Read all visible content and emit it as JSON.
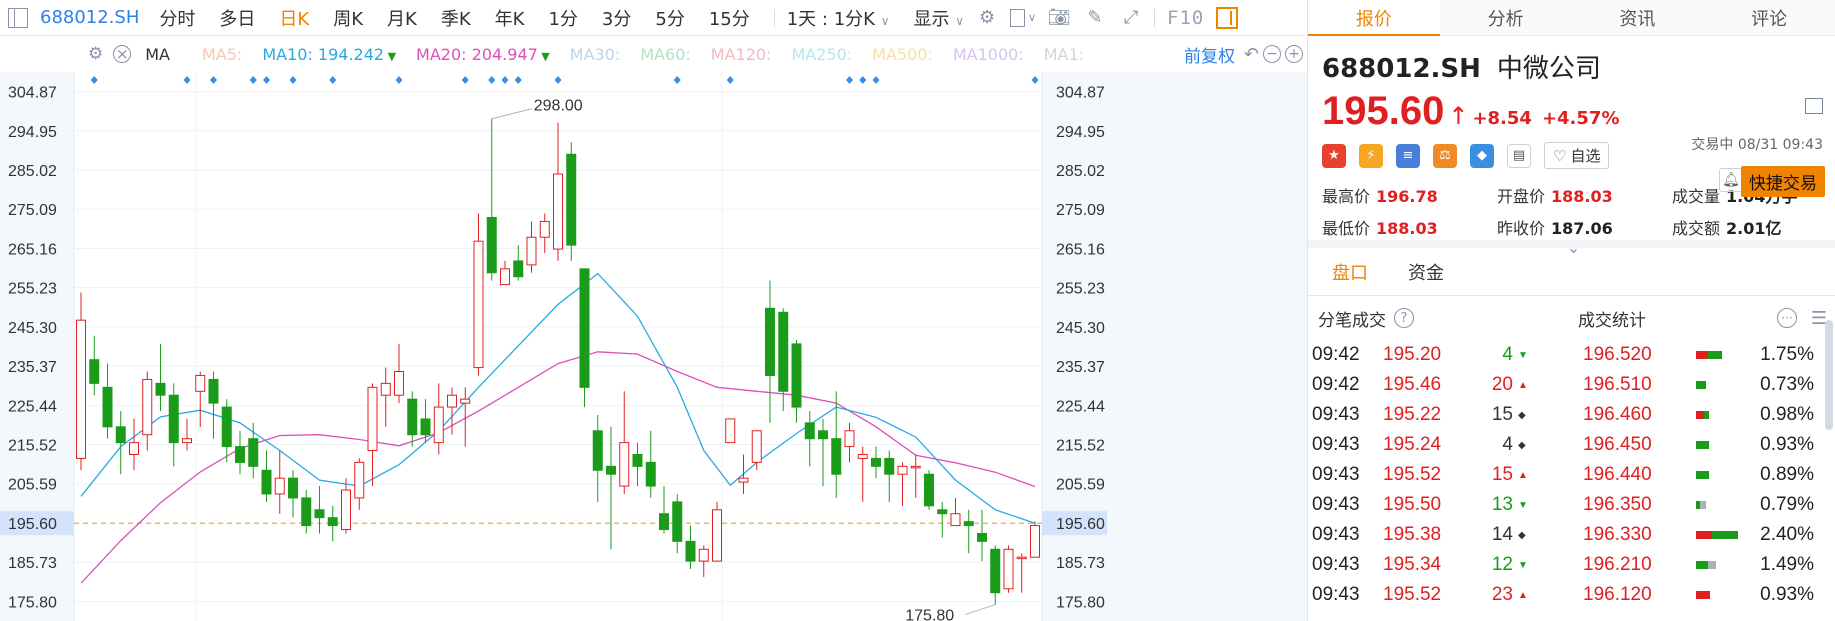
{
  "toolbar": {
    "symbol": "688012.SH",
    "periods": [
      "分时",
      "多日",
      "日K",
      "周K",
      "月K",
      "季K",
      "年K",
      "1分",
      "3分",
      "5分",
      "15分"
    ],
    "active_period": "日K",
    "range": "1天 : 1分K",
    "display": "显示",
    "f10": "F10"
  },
  "ma": {
    "label": "MA",
    "items": [
      {
        "text": "MA5:",
        "color": "#f6c6b3"
      },
      {
        "text": "MA10: 194.242",
        "color": "#29a9e1",
        "arrow": "down",
        "arrow_color": "#1a9c1a"
      },
      {
        "text": "MA20: 204.947",
        "color": "#de4fb8",
        "arrow": "down",
        "arrow_color": "#1a9c1a"
      },
      {
        "text": "MA30:",
        "color": "#b8d4ec"
      },
      {
        "text": "MA60:",
        "color": "#b2e2c4"
      },
      {
        "text": "MA120:",
        "color": "#f4b9c3"
      },
      {
        "text": "MA250:",
        "color": "#b5e6f0"
      },
      {
        "text": "MA500:",
        "color": "#f7e0a8"
      },
      {
        "text": "MA1000:",
        "color": "#d4c4ec"
      },
      {
        "text": "MA1:",
        "color": "#cfd6de"
      }
    ],
    "adjust": "前复权"
  },
  "chart_data": {
    "type": "candlestick",
    "ylim": [
      170.84,
      309.83
    ],
    "y_ticks": [
      "304.87",
      "294.95",
      "285.02",
      "275.09",
      "265.16",
      "255.23",
      "245.30",
      "235.37",
      "225.44",
      "215.52",
      "205.59",
      "195.60",
      "185.73",
      "175.80"
    ],
    "current_price": 195.6,
    "current_price_label": "195.60",
    "high_label": "298.00",
    "low_label": "175.80",
    "candles": [
      [
        212,
        247,
        209,
        254
      ],
      [
        237,
        231,
        228,
        243
      ],
      [
        230,
        220,
        217,
        236
      ],
      [
        220,
        216,
        208,
        224
      ],
      [
        213,
        216,
        209,
        222
      ],
      [
        218,
        232,
        214,
        234
      ],
      [
        231,
        228,
        224,
        241
      ],
      [
        228,
        216,
        210,
        231
      ],
      [
        216,
        217,
        214,
        222
      ],
      [
        229,
        233,
        220,
        234
      ],
      [
        232,
        226,
        217,
        234
      ],
      [
        225,
        215,
        211,
        227
      ],
      [
        215,
        211,
        208,
        219
      ],
      [
        217,
        210,
        207,
        221
      ],
      [
        209,
        203,
        201,
        214
      ],
      [
        203,
        207,
        198,
        214
      ],
      [
        207,
        202,
        197,
        209
      ],
      [
        202,
        195,
        193,
        204
      ],
      [
        199,
        197,
        193,
        205
      ],
      [
        197,
        195,
        191,
        200
      ],
      [
        194,
        204,
        193,
        207
      ],
      [
        202,
        211,
        199,
        212
      ],
      [
        214,
        230,
        205,
        231
      ],
      [
        228,
        231,
        220,
        235
      ],
      [
        228,
        234,
        226,
        241
      ],
      [
        227,
        218,
        215,
        229
      ],
      [
        222,
        218,
        216,
        227
      ],
      [
        216,
        225,
        213,
        231
      ],
      [
        225,
        228,
        218,
        230
      ],
      [
        226,
        227,
        215,
        230
      ],
      [
        235,
        267,
        233,
        274
      ],
      [
        273,
        259,
        257,
        298
      ],
      [
        256,
        260,
        257,
        262
      ],
      [
        262,
        258,
        257,
        266
      ],
      [
        261,
        268,
        259,
        272
      ],
      [
        268,
        272,
        264,
        274
      ],
      [
        265,
        284,
        262,
        297
      ],
      [
        289,
        266,
        262,
        292
      ],
      [
        260,
        230,
        225,
        259
      ],
      [
        219,
        209,
        201,
        223
      ],
      [
        210,
        208,
        189,
        220
      ],
      [
        205,
        216,
        203,
        229
      ],
      [
        213,
        210,
        205,
        216
      ],
      [
        211,
        205,
        202,
        219
      ],
      [
        198,
        194,
        193,
        205
      ],
      [
        201,
        191,
        188,
        203
      ],
      [
        191,
        186,
        184,
        195
      ],
      [
        186,
        189,
        182,
        190
      ],
      [
        186,
        199,
        186,
        201
      ],
      [
        216,
        222,
        216,
        222
      ],
      [
        206,
        207,
        203,
        213
      ],
      [
        211,
        219,
        209,
        219
      ],
      [
        250,
        233,
        221,
        257
      ],
      [
        249,
        229,
        224,
        250
      ],
      [
        241,
        225,
        221,
        242
      ],
      [
        221,
        217,
        210,
        224
      ],
      [
        219,
        217,
        205,
        222
      ],
      [
        217,
        208,
        202,
        229
      ],
      [
        215,
        219,
        211,
        221
      ],
      [
        212,
        213,
        201,
        215
      ],
      [
        212,
        210,
        207,
        215
      ],
      [
        212,
        208,
        201,
        214
      ],
      [
        208,
        210,
        200,
        211
      ],
      [
        210,
        210,
        202,
        213
      ],
      [
        208,
        200,
        199,
        209
      ],
      [
        199,
        198,
        192,
        201
      ],
      [
        195,
        198,
        196,
        202
      ],
      [
        196,
        195,
        188,
        199
      ],
      [
        193,
        191,
        186,
        199
      ],
      [
        189,
        178,
        175,
        190
      ],
      [
        179,
        189,
        178,
        190
      ],
      [
        187,
        187,
        178,
        188
      ],
      [
        187,
        195,
        187,
        196
      ]
    ],
    "ma10": [
      [
        0,
        202.4
      ],
      [
        3,
        215.0
      ],
      [
        6,
        222.5
      ],
      [
        9,
        224.2
      ],
      [
        12,
        221.0
      ],
      [
        15,
        214.0
      ],
      [
        18,
        206.5
      ],
      [
        21,
        205.0
      ],
      [
        24,
        210.4
      ],
      [
        27,
        219.0
      ],
      [
        30,
        230.0
      ],
      [
        33,
        240.5
      ],
      [
        36,
        251.0
      ],
      [
        39,
        258.8
      ],
      [
        42,
        248.0
      ],
      [
        45,
        230.0
      ],
      [
        47,
        214.0
      ],
      [
        49,
        205.2
      ],
      [
        51,
        211.0
      ],
      [
        54,
        218.3
      ],
      [
        57,
        225.0
      ],
      [
        60,
        222.4
      ],
      [
        63,
        217.4
      ],
      [
        66,
        206.5
      ],
      [
        69,
        199.0
      ],
      [
        72,
        195.6
      ]
    ],
    "ma20": [
      [
        0,
        180.4
      ],
      [
        3,
        191.2
      ],
      [
        6,
        200.8
      ],
      [
        9,
        208.6
      ],
      [
        12,
        214.5
      ],
      [
        15,
        217.8
      ],
      [
        18,
        218.0
      ],
      [
        21,
        216.8
      ],
      [
        24,
        215.2
      ],
      [
        27,
        218.5
      ],
      [
        30,
        224.0
      ],
      [
        33,
        230.0
      ],
      [
        36,
        236.0
      ],
      [
        39,
        239.0
      ],
      [
        42,
        238.4
      ],
      [
        45,
        234.0
      ],
      [
        48,
        230.0
      ],
      [
        51,
        229.0
      ],
      [
        54,
        228.0
      ],
      [
        57,
        226.0
      ],
      [
        60,
        220.0
      ],
      [
        63,
        212.8
      ],
      [
        66,
        210.9
      ],
      [
        69,
        208.5
      ],
      [
        72,
        204.9
      ]
    ],
    "event_markers": [
      1,
      8,
      10,
      13,
      14,
      16,
      19,
      24,
      29,
      31,
      32,
      33,
      36,
      45,
      49,
      58,
      59,
      60,
      72
    ]
  },
  "quote": {
    "tabs": [
      "报价",
      "分析",
      "资讯",
      "评论"
    ],
    "symbol": "688012.SH",
    "name": "中微公司",
    "price": "195.60",
    "arrow": "↑",
    "change": "+8.54",
    "change_pct": "+4.57%",
    "status": "交易中 08/31 09:43",
    "watch": "自选",
    "trade": "快捷交易",
    "stats": [
      {
        "label": "最高价",
        "value": "196.78",
        "tone": "up"
      },
      {
        "label": "开盘价",
        "value": "188.03",
        "tone": "up"
      },
      {
        "label": "成交量",
        "value": "1.04万手",
        "tone": "dark"
      },
      {
        "label": "最低价",
        "value": "188.03",
        "tone": "up"
      },
      {
        "label": "昨收价",
        "value": "187.06",
        "tone": "dark"
      },
      {
        "label": "成交额",
        "value": "2.01亿",
        "tone": "dark"
      }
    ]
  },
  "sub_tabs": [
    "盘口",
    "资金"
  ],
  "trades": {
    "left_title": "分笔成交",
    "right_title": "成交统计",
    "rows": [
      {
        "time": "09:42",
        "price": "195.20",
        "vol": "4",
        "vol_color": "green",
        "dir": "down",
        "sprice": "196.520",
        "bars": [
          [
            12,
            "#e02020"
          ],
          [
            14,
            "#1a9c1a"
          ]
        ],
        "pct": "1.75%"
      },
      {
        "time": "09:42",
        "price": "195.46",
        "vol": "20",
        "vol_color": "red",
        "dir": "up",
        "sprice": "196.510",
        "bars": [
          [
            10,
            "#1a9c1a"
          ]
        ],
        "pct": "0.73%"
      },
      {
        "time": "09:43",
        "price": "195.22",
        "vol": "15",
        "vol_color": "dark",
        "dir": "flat",
        "sprice": "196.460",
        "bars": [
          [
            8,
            "#e02020"
          ],
          [
            5,
            "#1a9c1a"
          ]
        ],
        "pct": "0.98%"
      },
      {
        "time": "09:43",
        "price": "195.24",
        "vol": "4",
        "vol_color": "dark",
        "dir": "flat",
        "sprice": "196.450",
        "bars": [
          [
            13,
            "#1a9c1a"
          ]
        ],
        "pct": "0.93%"
      },
      {
        "time": "09:43",
        "price": "195.52",
        "vol": "15",
        "vol_color": "red",
        "dir": "up",
        "sprice": "196.440",
        "bars": [
          [
            13,
            "#1a9c1a"
          ]
        ],
        "pct": "0.89%"
      },
      {
        "time": "09:43",
        "price": "195.50",
        "vol": "13",
        "vol_color": "green",
        "dir": "down",
        "sprice": "196.350",
        "bars": [
          [
            4,
            "#1a9c1a"
          ],
          [
            6,
            "#aab2bd"
          ]
        ],
        "pct": "0.79%"
      },
      {
        "time": "09:43",
        "price": "195.38",
        "vol": "14",
        "vol_color": "dark",
        "dir": "flat",
        "sprice": "196.330",
        "bars": [
          [
            16,
            "#e02020"
          ],
          [
            26,
            "#1a9c1a"
          ]
        ],
        "pct": "2.40%"
      },
      {
        "time": "09:43",
        "price": "195.34",
        "vol": "12",
        "vol_color": "green",
        "dir": "down",
        "sprice": "196.210",
        "bars": [
          [
            12,
            "#1a9c1a"
          ],
          [
            8,
            "#aab2bd"
          ]
        ],
        "pct": "1.49%"
      },
      {
        "time": "09:43",
        "price": "195.52",
        "vol": "23",
        "vol_color": "red",
        "dir": "up",
        "sprice": "196.120",
        "bars": [
          [
            14,
            "#e02020"
          ]
        ],
        "pct": "0.93%"
      }
    ]
  }
}
